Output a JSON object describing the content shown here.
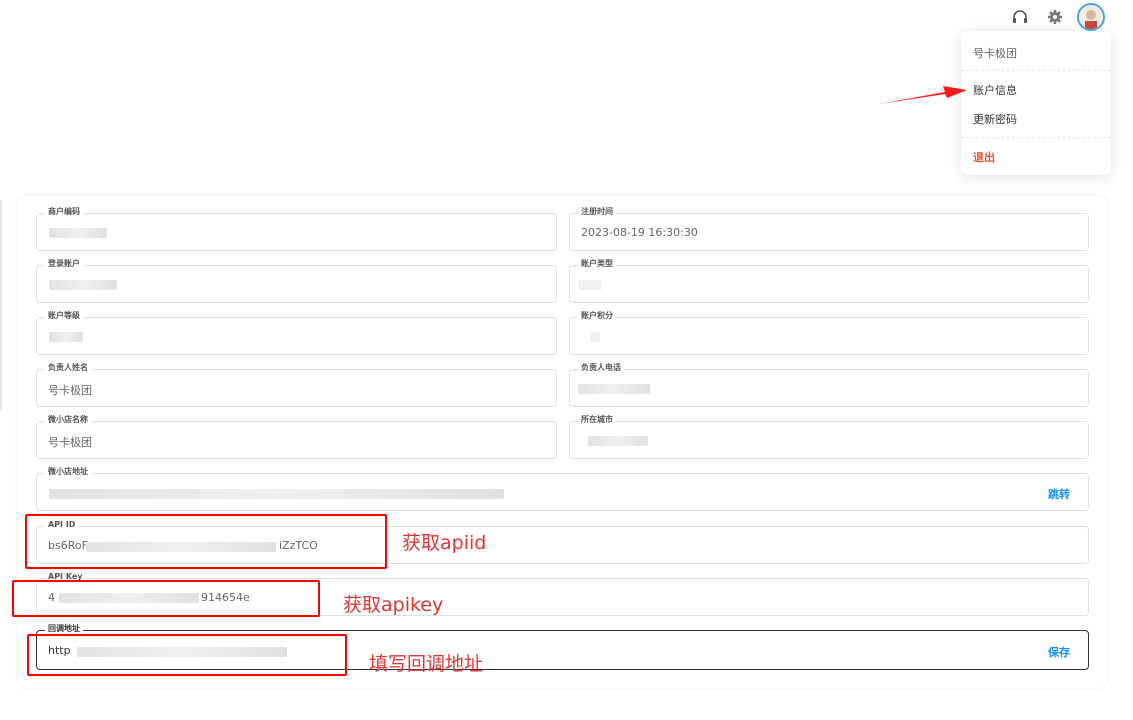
{
  "menu": {
    "company": "号卡极团",
    "account_info": "账户信息",
    "change_password": "更新密码",
    "logout": "退出"
  },
  "fields": {
    "merchant_code": {
      "label": "商户编码",
      "value": ""
    },
    "register_time": {
      "label": "注册时间",
      "value": "2023-08-19 16:30:30"
    },
    "login_account": {
      "label": "登录账户",
      "value": ""
    },
    "account_type": {
      "label": "账户类型",
      "value": ""
    },
    "account_level": {
      "label": "账户等级",
      "value": ""
    },
    "account_points": {
      "label": "账户积分",
      "value": ""
    },
    "contact_name": {
      "label": "负责人姓名",
      "value": "号卡极团"
    },
    "contact_phone": {
      "label": "负责人电话",
      "value": ""
    },
    "shop_name": {
      "label": "微小店名称",
      "value": "号卡极团"
    },
    "city": {
      "label": "所在城市",
      "value": ""
    },
    "shop_url": {
      "label": "微小店地址",
      "value": "",
      "action": "跳转"
    },
    "api_id": {
      "label": "API ID",
      "value_start": "bs6RoF",
      "value_end": "iZzTCO"
    },
    "api_key": {
      "label": "API Key",
      "value_start": "4",
      "value_end": "914654e"
    },
    "callback_url": {
      "label": "回调地址",
      "value": "http",
      "action": "保存"
    }
  },
  "annotations": {
    "get_apiid": "获取apiid",
    "get_apikey": "获取apikey",
    "fill_callback": "填写回调地址"
  },
  "colors": {
    "annotation": "#ff0000",
    "link": "#1890ff",
    "logout": "#e8542e"
  }
}
